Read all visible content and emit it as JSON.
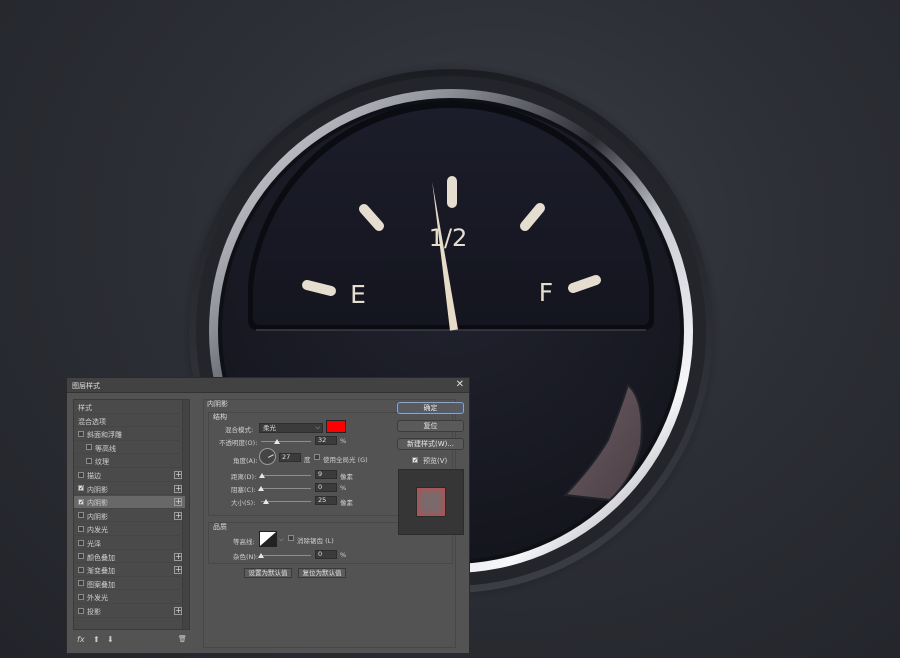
{
  "gauge": {
    "label_empty": "E",
    "label_half": "1/2",
    "label_full": "F",
    "fuel_level_fraction": 0.45,
    "colors": {
      "face": "#181925",
      "needle": "#e7dcc8",
      "ticks": "#e4ddd0",
      "bezel": "#d9dbe0"
    }
  },
  "dialog": {
    "title": "图层样式",
    "close_glyph": "✕",
    "style_list": [
      {
        "label": "样式",
        "checkbox": false,
        "checked": false,
        "indent": 0,
        "plus": false,
        "selected": false
      },
      {
        "label": "混合选项",
        "checkbox": false,
        "checked": false,
        "indent": 0,
        "plus": false,
        "selected": false
      },
      {
        "label": "斜面和浮雕",
        "checkbox": true,
        "checked": false,
        "indent": 0,
        "plus": false,
        "selected": false
      },
      {
        "label": "等高线",
        "checkbox": true,
        "checked": false,
        "indent": 1,
        "plus": false,
        "selected": false
      },
      {
        "label": "纹理",
        "checkbox": true,
        "checked": false,
        "indent": 1,
        "plus": false,
        "selected": false
      },
      {
        "label": "描边",
        "checkbox": true,
        "checked": false,
        "indent": 0,
        "plus": true,
        "selected": false
      },
      {
        "label": "内阴影",
        "checkbox": true,
        "checked": true,
        "indent": 0,
        "plus": true,
        "selected": false
      },
      {
        "label": "内阴影",
        "checkbox": true,
        "checked": true,
        "indent": 0,
        "plus": true,
        "selected": true
      },
      {
        "label": "内阴影",
        "checkbox": true,
        "checked": false,
        "indent": 0,
        "plus": true,
        "selected": false
      },
      {
        "label": "内发光",
        "checkbox": true,
        "checked": false,
        "indent": 0,
        "plus": false,
        "selected": false
      },
      {
        "label": "光泽",
        "checkbox": true,
        "checked": false,
        "indent": 0,
        "plus": false,
        "selected": false
      },
      {
        "label": "颜色叠加",
        "checkbox": true,
        "checked": false,
        "indent": 0,
        "plus": true,
        "selected": false
      },
      {
        "label": "渐变叠加",
        "checkbox": true,
        "checked": false,
        "indent": 0,
        "plus": true,
        "selected": false
      },
      {
        "label": "图案叠加",
        "checkbox": true,
        "checked": false,
        "indent": 0,
        "plus": false,
        "selected": false
      },
      {
        "label": "外发光",
        "checkbox": true,
        "checked": false,
        "indent": 0,
        "plus": false,
        "selected": false
      },
      {
        "label": "投影",
        "checkbox": true,
        "checked": false,
        "indent": 0,
        "plus": true,
        "selected": false
      }
    ],
    "footer": {
      "fx": "fx",
      "up": "⬆",
      "down": "⬇",
      "trash": "🗑"
    },
    "panel": {
      "section_title": "内阴影",
      "structure_title": "结构",
      "blend_mode_label": "混合模式:",
      "blend_mode_value": "柔光",
      "blend_color": "#ff0000",
      "opacity_label": "不透明度(O):",
      "opacity_value": "32",
      "opacity_fraction": 0.32,
      "angle_label": "角度(A):",
      "angle_value": "27",
      "angle_unit": "度",
      "global_light_label": "使用全局光 (G)",
      "distance_label": "距离(D):",
      "distance_value": "9",
      "distance_fraction": 0.02,
      "choke_label": "阻塞(C):",
      "choke_value": "0",
      "choke_fraction": 0.0,
      "size_label": "大小(S):",
      "size_value": "25",
      "size_fraction": 0.1,
      "unit_px": "像素",
      "unit_pct": "%",
      "quality_title": "品质",
      "contour_label": "等高线:",
      "antialias_label": "消除锯齿 (L)",
      "noise_label": "杂色(N):",
      "noise_value": "0",
      "noise_fraction": 0.0,
      "make_default": "设置为默认值",
      "reset_default": "复位为默认值"
    },
    "buttons": {
      "ok": "确定",
      "reset": "复位",
      "new_style": "新建样式(W)...",
      "preview_label": "预览(V)",
      "preview_checked": true
    }
  }
}
